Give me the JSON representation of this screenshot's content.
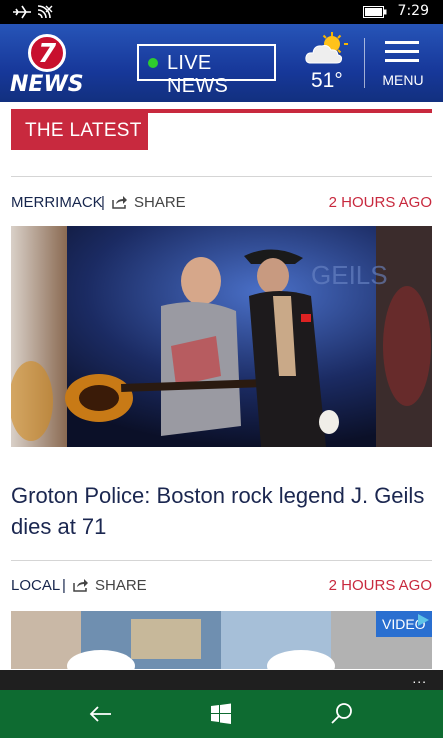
{
  "status_bar": {
    "time": "7:29",
    "icons": [
      "airplane-mode-icon",
      "wifi-icon",
      "battery-icon"
    ]
  },
  "header": {
    "logo_number": "7",
    "logo_text": "NEWS",
    "live_button_label": "LIVE NEWS",
    "live_indicator_color": "#2ecc2e",
    "weather_icon": "partly-cloudy-icon",
    "temperature": "51°",
    "menu_label": "MENU"
  },
  "section": {
    "title": "THE LATEST",
    "accent_color": "#c8293e"
  },
  "articles": [
    {
      "category": "MERRIMACK",
      "separator": "|",
      "share_label": "SHARE",
      "time": "2 HOURS AGO",
      "image": "guitarists-on-stage-photo",
      "headline": "Groton Police: Boston rock legend J. Geils dies at 71"
    },
    {
      "category": "LOCAL",
      "separator": "|",
      "share_label": "SHARE",
      "time": "2 HOURS AGO"
    }
  ],
  "ad": {
    "badge": "VIDEO",
    "icon": "ad-choices-icon"
  },
  "app_bar": {
    "more_label": "..."
  },
  "nav_bar": {
    "buttons": [
      "back-icon",
      "windows-start-icon",
      "search-icon"
    ]
  }
}
